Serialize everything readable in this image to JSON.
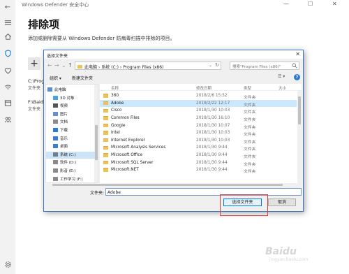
{
  "window": {
    "title": "Windows Defender 安全中心",
    "back_icon": "←",
    "minimize": "—",
    "maximize": "☐",
    "close": "✕"
  },
  "rail": {
    "items": [
      "menu-icon",
      "home-icon",
      "shield-icon",
      "heart-icon",
      "wifi-icon",
      "browser-icon",
      "family-icon",
      "gear-icon"
    ]
  },
  "page": {
    "heading": "排除项",
    "description": "添加或删除需要从 Windows Defender 防病毒扫描中排除的项目。",
    "add_label": "+"
  },
  "exclusions": [
    {
      "path": "C:\\Prog",
      "type": "文件夹"
    },
    {
      "path": "F:\\Baid",
      "type": "文件夹"
    }
  ],
  "dialog": {
    "title": "选择文件夹",
    "close": "✕",
    "breadcrumb": "此电脑 › 系统 (C:) › Program Files (x86)",
    "search_placeholder": "搜索\"Program Files (x86)\"",
    "organize": "组织 ▾",
    "new_folder": "新建文件夹",
    "view_toggle": "☰ ▾",
    "help": "?",
    "nav": [
      {
        "label": "此电脑",
        "icon": "computer-icon",
        "color": "#5a8fd6",
        "selected": false
      },
      {
        "label": "3D 对象",
        "icon": "3d-objects-icon",
        "color": "#4aa3df",
        "selected": false
      },
      {
        "label": "视频",
        "icon": "video-icon",
        "color": "#555555",
        "selected": false
      },
      {
        "label": "图片",
        "icon": "pictures-icon",
        "color": "#6b8ec9",
        "selected": false
      },
      {
        "label": "文档",
        "icon": "documents-icon",
        "color": "#8c8c8c",
        "selected": false
      },
      {
        "label": "下载",
        "icon": "downloads-icon",
        "color": "#2b7bd0",
        "selected": false
      },
      {
        "label": "音乐",
        "icon": "music-icon",
        "color": "#3a7bd5",
        "selected": false
      },
      {
        "label": "桌面",
        "icon": "desktop-icon",
        "color": "#3b7fc4",
        "selected": false
      },
      {
        "label": "系统 (C:)",
        "icon": "drive-icon",
        "color": "#6f7d8c",
        "selected": true
      },
      {
        "label": "软件 (D:)",
        "icon": "drive-icon",
        "color": "#8a8a8a",
        "selected": false
      },
      {
        "label": "影音 (E:)",
        "icon": "drive-icon",
        "color": "#8a8a8a",
        "selected": false
      },
      {
        "label": "工作学习 (F:)",
        "icon": "drive-icon",
        "color": "#8a8a8a",
        "selected": false
      }
    ],
    "columns": {
      "name": "名称",
      "date": "修改日期",
      "type": "类型",
      "size": "大小"
    },
    "files": [
      {
        "name": "360",
        "date": "2018/2/6 15:52",
        "type": "文件夹",
        "selected": false
      },
      {
        "name": "Adobe",
        "date": "2018/2/22 12:17",
        "type": "文件夹",
        "selected": true
      },
      {
        "name": "Cisco",
        "date": "2018/1/30 10:03",
        "type": "文件夹",
        "selected": false
      },
      {
        "name": "Common Files",
        "date": "2018/1/30 16:10",
        "type": "文件夹",
        "selected": false
      },
      {
        "name": "Google",
        "date": "2018/1/30 10:07",
        "type": "文件夹",
        "selected": false
      },
      {
        "name": "Intel",
        "date": "2018/1/30 10:03",
        "type": "文件夹",
        "selected": false
      },
      {
        "name": "Internet Explorer",
        "date": "2018/1/30 10:03",
        "type": "文件夹",
        "selected": false
      },
      {
        "name": "Microsoft Analysis Services",
        "date": "2018/1/30 9:44",
        "type": "文件夹",
        "selected": false
      },
      {
        "name": "Microsoft Office",
        "date": "2018/1/30 9:44",
        "type": "文件夹",
        "selected": false
      },
      {
        "name": "Microsoft SQL Server",
        "date": "2018/1/30 9:44",
        "type": "文件夹",
        "selected": false
      },
      {
        "name": "Microsoft.NET",
        "date": "2018/1/30 9:44",
        "type": "文件夹",
        "selected": false
      }
    ],
    "folder_label": "文件夹:",
    "folder_value": "Adobe",
    "select_button": "选择文件夹",
    "cancel_button": "取消"
  },
  "watermark": {
    "main": "Baidu",
    "sub": "jingyan.baidu.com"
  },
  "colors": {
    "accent": "#0078d7",
    "selection": "#cce8ff",
    "highlight": "#e53935",
    "folder": "#e9c25a"
  }
}
